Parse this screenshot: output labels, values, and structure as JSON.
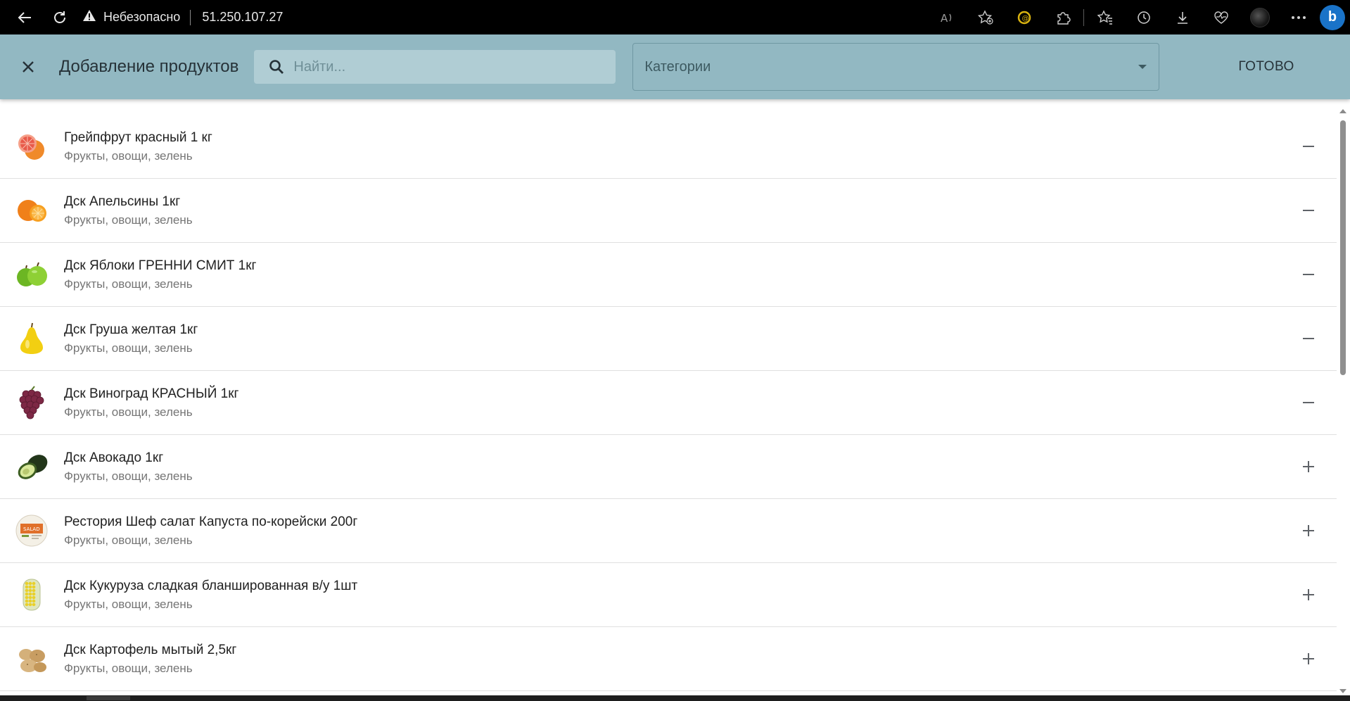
{
  "browser": {
    "security_text": "Небезопасно",
    "url": "51.250.107.27",
    "icons": [
      "back-icon",
      "reload-icon",
      "warning-icon",
      "read-aloud-icon",
      "add-favorite-icon",
      "coin-icon",
      "extensions-icon",
      "favorites-icon",
      "history-icon",
      "downloads-icon",
      "health-icon",
      "profile-icon",
      "more-icon",
      "bing-icon"
    ]
  },
  "header": {
    "title": "Добавление продуктов",
    "search_placeholder": "Найти...",
    "categories_label": "Категории",
    "done_label": "ГОТОВО"
  },
  "products": [
    {
      "name": "Грейпфрут красный 1 кг",
      "category": "Фрукты, овощи, зелень",
      "image": "grapefruit",
      "action": "remove",
      "color": "#f07a3a"
    },
    {
      "name": "Дск Апельсины 1кг",
      "category": "Фрукты, овощи, зелень",
      "image": "orange",
      "action": "remove",
      "color": "#f28a1e"
    },
    {
      "name": "Дск Яблоки ГРЕННИ СМИТ 1кг",
      "category": "Фрукты, овощи, зелень",
      "image": "green-apple",
      "action": "remove",
      "color": "#7cc42b"
    },
    {
      "name": "Дск Груша желтая 1кг",
      "category": "Фрукты, овощи, зелень",
      "image": "pear",
      "action": "remove",
      "color": "#f5d20f"
    },
    {
      "name": "Дск Виноград КРАСНЫЙ 1кг",
      "category": "Фрукты, овощи, зелень",
      "image": "grapes",
      "action": "remove",
      "color": "#8a2f4a"
    },
    {
      "name": "Дск Авокадо 1кг",
      "category": "Фрукты, овощи, зелень",
      "image": "avocado",
      "action": "add",
      "color": "#2f4d1c"
    },
    {
      "name": "Рестория Шеф салат Капуста по-корейски 200г",
      "category": "Фрукты, овощи, зелень",
      "image": "salad-pack",
      "action": "add",
      "color": "#e0702a"
    },
    {
      "name": "Дск Кукуруза сладкая бланшированная в/у 1шт",
      "category": "Фрукты, овощи, зелень",
      "image": "corn",
      "action": "add",
      "color": "#d8c22a"
    },
    {
      "name": "Дск Картофель мытый 2,5кг",
      "category": "Фрукты, овощи, зелень",
      "image": "potato",
      "action": "add",
      "color": "#c9a46a"
    }
  ],
  "colors": {
    "header_bg": "#92b8c2",
    "search_bg": "#b0cdd4",
    "browser_bg": "#000000"
  }
}
